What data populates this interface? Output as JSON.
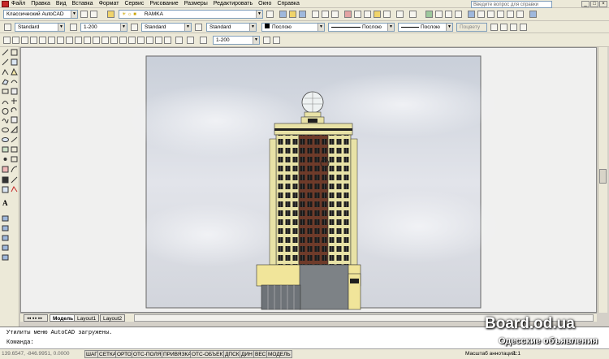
{
  "menubar": {
    "items": [
      "Файл",
      "Правка",
      "Вид",
      "Вставка",
      "Формат",
      "Сервис",
      "Рисование",
      "Размеры",
      "Редактировать",
      "Окно",
      "Справка"
    ],
    "help_placeholder": "Введите вопрос для справки"
  },
  "toolbar1": {
    "workspace": "Классический AutoCAD",
    "layer": "RAMKA"
  },
  "toolbar2": {
    "text_style": "Standard",
    "dim_scale": "1-200",
    "dim_style": "Standard",
    "table_style": "Standard",
    "color": "Послою",
    "linetype": "Послою",
    "lineweight": "Послою",
    "plotstyle": "Поцвету"
  },
  "toolbar3": {
    "scale": "1-200"
  },
  "tabs": [
    "Модель",
    "Layout1",
    "Layout2"
  ],
  "command": {
    "line1": "Утилиты меню AutoCAD загружены.",
    "line2": "Команда:"
  },
  "status": {
    "coords": "139.6547, -846.9951, 0.0000",
    "toggles": [
      "ШАГ",
      "СЕТКА",
      "ОРТО",
      "ОТС-ПОЛЯР",
      "ПРИВЯЗКА",
      "ОТС-ОБЪЕКТ",
      "ДПСК",
      "ДИН",
      "ВЕС",
      "МОДЕЛЬ"
    ],
    "annot_scale_label": "Масштаб аннотаций:",
    "annot_scale_value": "1:1"
  },
  "watermark": {
    "site": "Board.od.ua",
    "subtitle": "Одесские объявления"
  },
  "colors": {
    "sky": "#d7dbe3",
    "facade_cream": "#e8e2a6",
    "facade_brown": "#6e3b2a",
    "podium": "#f1e59a",
    "window_dark": "#1f1f1f"
  }
}
